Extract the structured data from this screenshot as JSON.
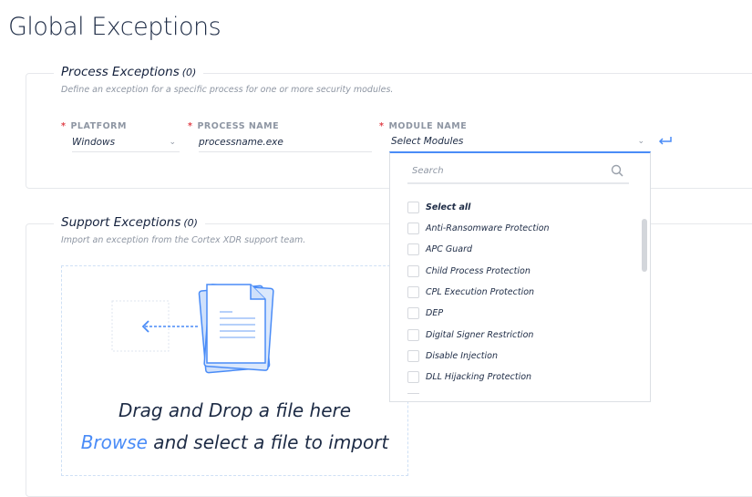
{
  "page_title": "Global Exceptions",
  "process": {
    "title": "Process Exceptions",
    "count": "(0)",
    "description": "Define an exception for a specific process for one or more security modules.",
    "platform_label": "PLATFORM",
    "platform_value": "Windows",
    "process_label": "PROCESS NAME",
    "process_value": "processname.exe",
    "module_label": "MODULE NAME",
    "module_value": "Select Modules",
    "required_mark": "*"
  },
  "dropdown": {
    "search_placeholder": "Search",
    "select_all": "Select all",
    "items": [
      "Anti-Ransomware Protection",
      "APC Guard",
      "Child Process Protection",
      "CPL Execution Protection",
      "DEP",
      "Digital Signer Restriction",
      "Disable Injection",
      "DLL Hijacking Protection"
    ]
  },
  "support": {
    "title": "Support Exceptions",
    "count": "(0)",
    "description": "Import an exception from the Cortex XDR support team.",
    "drop_text": "Drag and Drop a file here",
    "browse_link": "Browse",
    "browse_rest": " and select a file to import"
  },
  "colors": {
    "accent": "#4a8cf7",
    "required": "#e0424a"
  }
}
